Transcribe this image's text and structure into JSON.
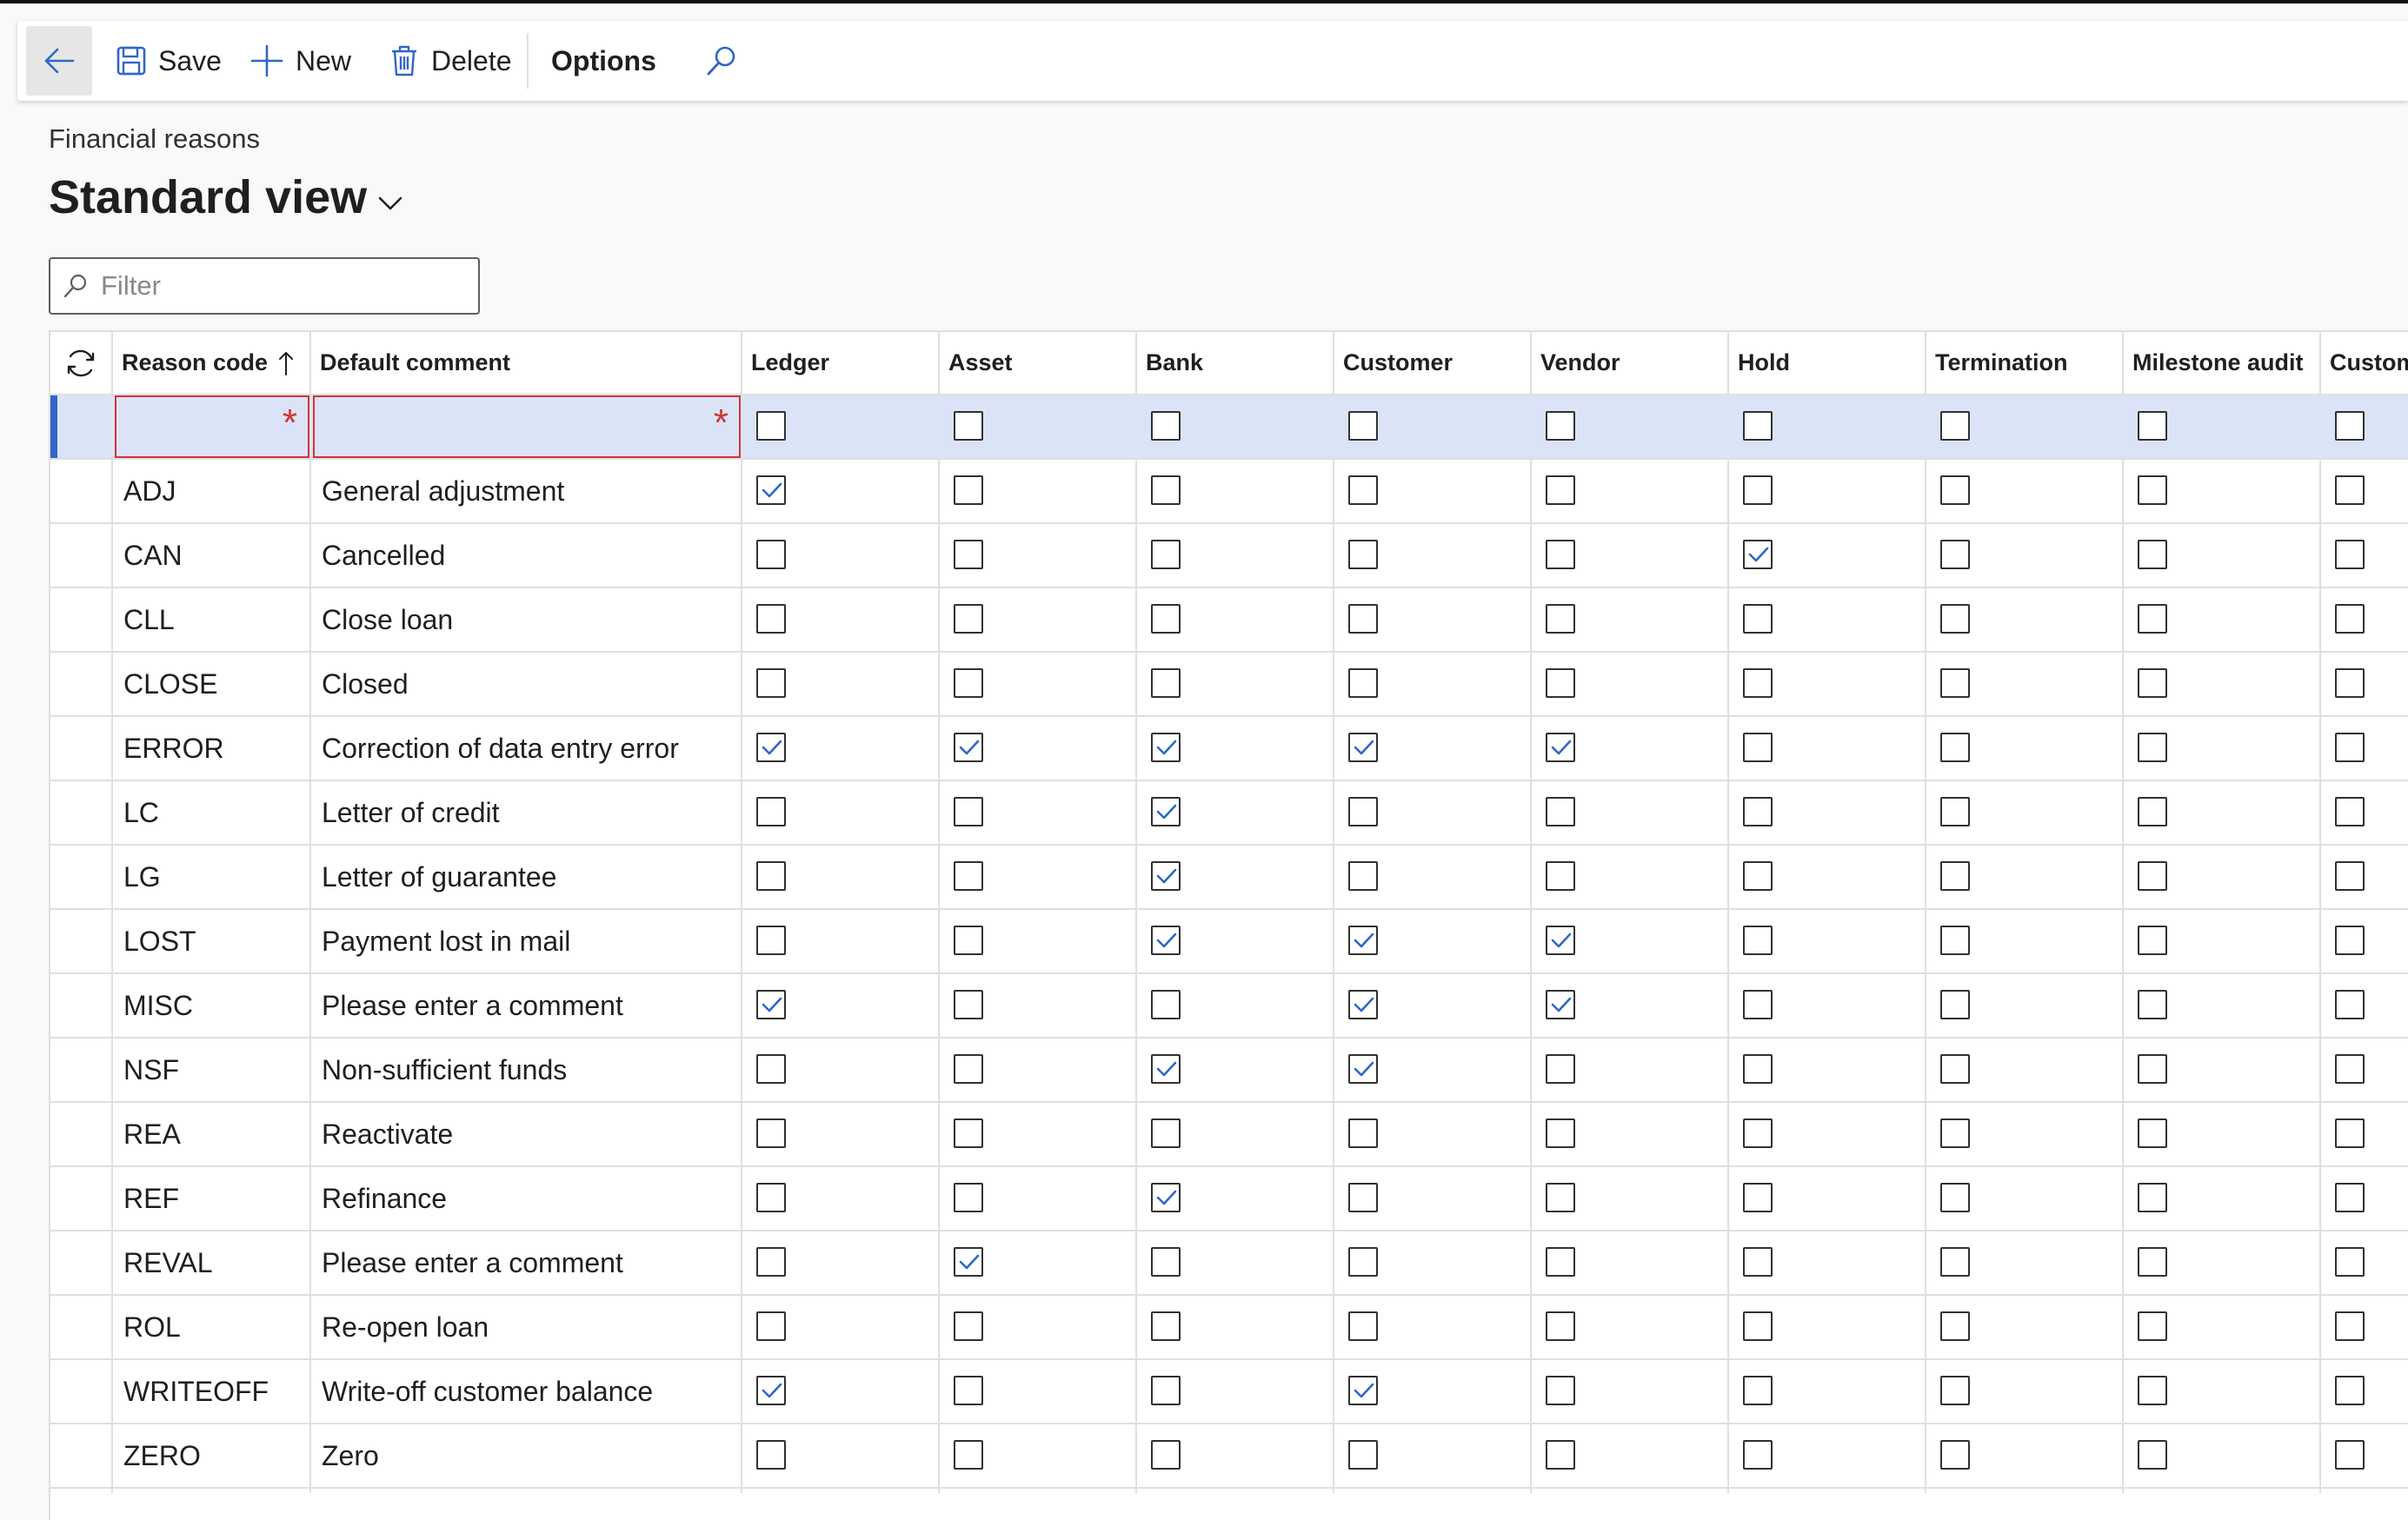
{
  "toolbar": {
    "save_label": "Save",
    "new_label": "New",
    "delete_label": "Delete",
    "options_label": "Options"
  },
  "page": {
    "caption": "Financial reasons",
    "view_title": "Standard view"
  },
  "filter": {
    "placeholder": "Filter",
    "value": ""
  },
  "accent_color": "#2f66c9",
  "required_color": "#d13438",
  "grid": {
    "columns": [
      {
        "label": "Reason code",
        "sort": "ascending"
      },
      {
        "label": "Default comment"
      },
      {
        "label": "Ledger"
      },
      {
        "label": "Asset"
      },
      {
        "label": "Bank"
      },
      {
        "label": "Customer"
      },
      {
        "label": "Vendor"
      },
      {
        "label": "Hold"
      },
      {
        "label": "Termination"
      },
      {
        "label": "Milestone audit"
      },
      {
        "label": "Custom"
      }
    ],
    "new_row": {
      "code": "",
      "comment": "",
      "required_marker": "*",
      "checks": [
        false,
        false,
        false,
        false,
        false,
        false,
        false,
        false,
        false
      ]
    },
    "rows": [
      {
        "code": "ADJ",
        "comment": "General adjustment",
        "checks": [
          true,
          false,
          false,
          false,
          false,
          false,
          false,
          false,
          false
        ]
      },
      {
        "code": "CAN",
        "comment": "Cancelled",
        "checks": [
          false,
          false,
          false,
          false,
          false,
          true,
          false,
          false,
          false
        ]
      },
      {
        "code": "CLL",
        "comment": "Close loan",
        "checks": [
          false,
          false,
          false,
          false,
          false,
          false,
          false,
          false,
          false
        ]
      },
      {
        "code": "CLOSE",
        "comment": "Closed",
        "checks": [
          false,
          false,
          false,
          false,
          false,
          false,
          false,
          false,
          false
        ]
      },
      {
        "code": "ERROR",
        "comment": "Correction of data entry error",
        "checks": [
          true,
          true,
          true,
          true,
          true,
          false,
          false,
          false,
          false
        ]
      },
      {
        "code": "LC",
        "comment": "Letter of credit",
        "checks": [
          false,
          false,
          true,
          false,
          false,
          false,
          false,
          false,
          false
        ]
      },
      {
        "code": "LG",
        "comment": "Letter of guarantee",
        "checks": [
          false,
          false,
          true,
          false,
          false,
          false,
          false,
          false,
          false
        ]
      },
      {
        "code": "LOST",
        "comment": "Payment lost in mail",
        "checks": [
          false,
          false,
          true,
          true,
          true,
          false,
          false,
          false,
          false
        ]
      },
      {
        "code": "MISC",
        "comment": "Please enter a comment",
        "checks": [
          true,
          false,
          false,
          true,
          true,
          false,
          false,
          false,
          false
        ]
      },
      {
        "code": "NSF",
        "comment": "Non-sufficient funds",
        "checks": [
          false,
          false,
          true,
          true,
          false,
          false,
          false,
          false,
          false
        ]
      },
      {
        "code": "REA",
        "comment": "Reactivate",
        "checks": [
          false,
          false,
          false,
          false,
          false,
          false,
          false,
          false,
          false
        ]
      },
      {
        "code": "REF",
        "comment": "Refinance",
        "checks": [
          false,
          false,
          true,
          false,
          false,
          false,
          false,
          false,
          false
        ]
      },
      {
        "code": "REVAL",
        "comment": "Please enter a comment",
        "checks": [
          false,
          true,
          false,
          false,
          false,
          false,
          false,
          false,
          false
        ]
      },
      {
        "code": "ROL",
        "comment": "Re-open loan",
        "checks": [
          false,
          false,
          false,
          false,
          false,
          false,
          false,
          false,
          false
        ]
      },
      {
        "code": "WRITEOFF",
        "comment": "Write-off customer balance",
        "checks": [
          true,
          false,
          false,
          true,
          false,
          false,
          false,
          false,
          false
        ]
      },
      {
        "code": "ZERO",
        "comment": "Zero",
        "checks": [
          false,
          false,
          false,
          false,
          false,
          false,
          false,
          false,
          false
        ]
      }
    ]
  }
}
